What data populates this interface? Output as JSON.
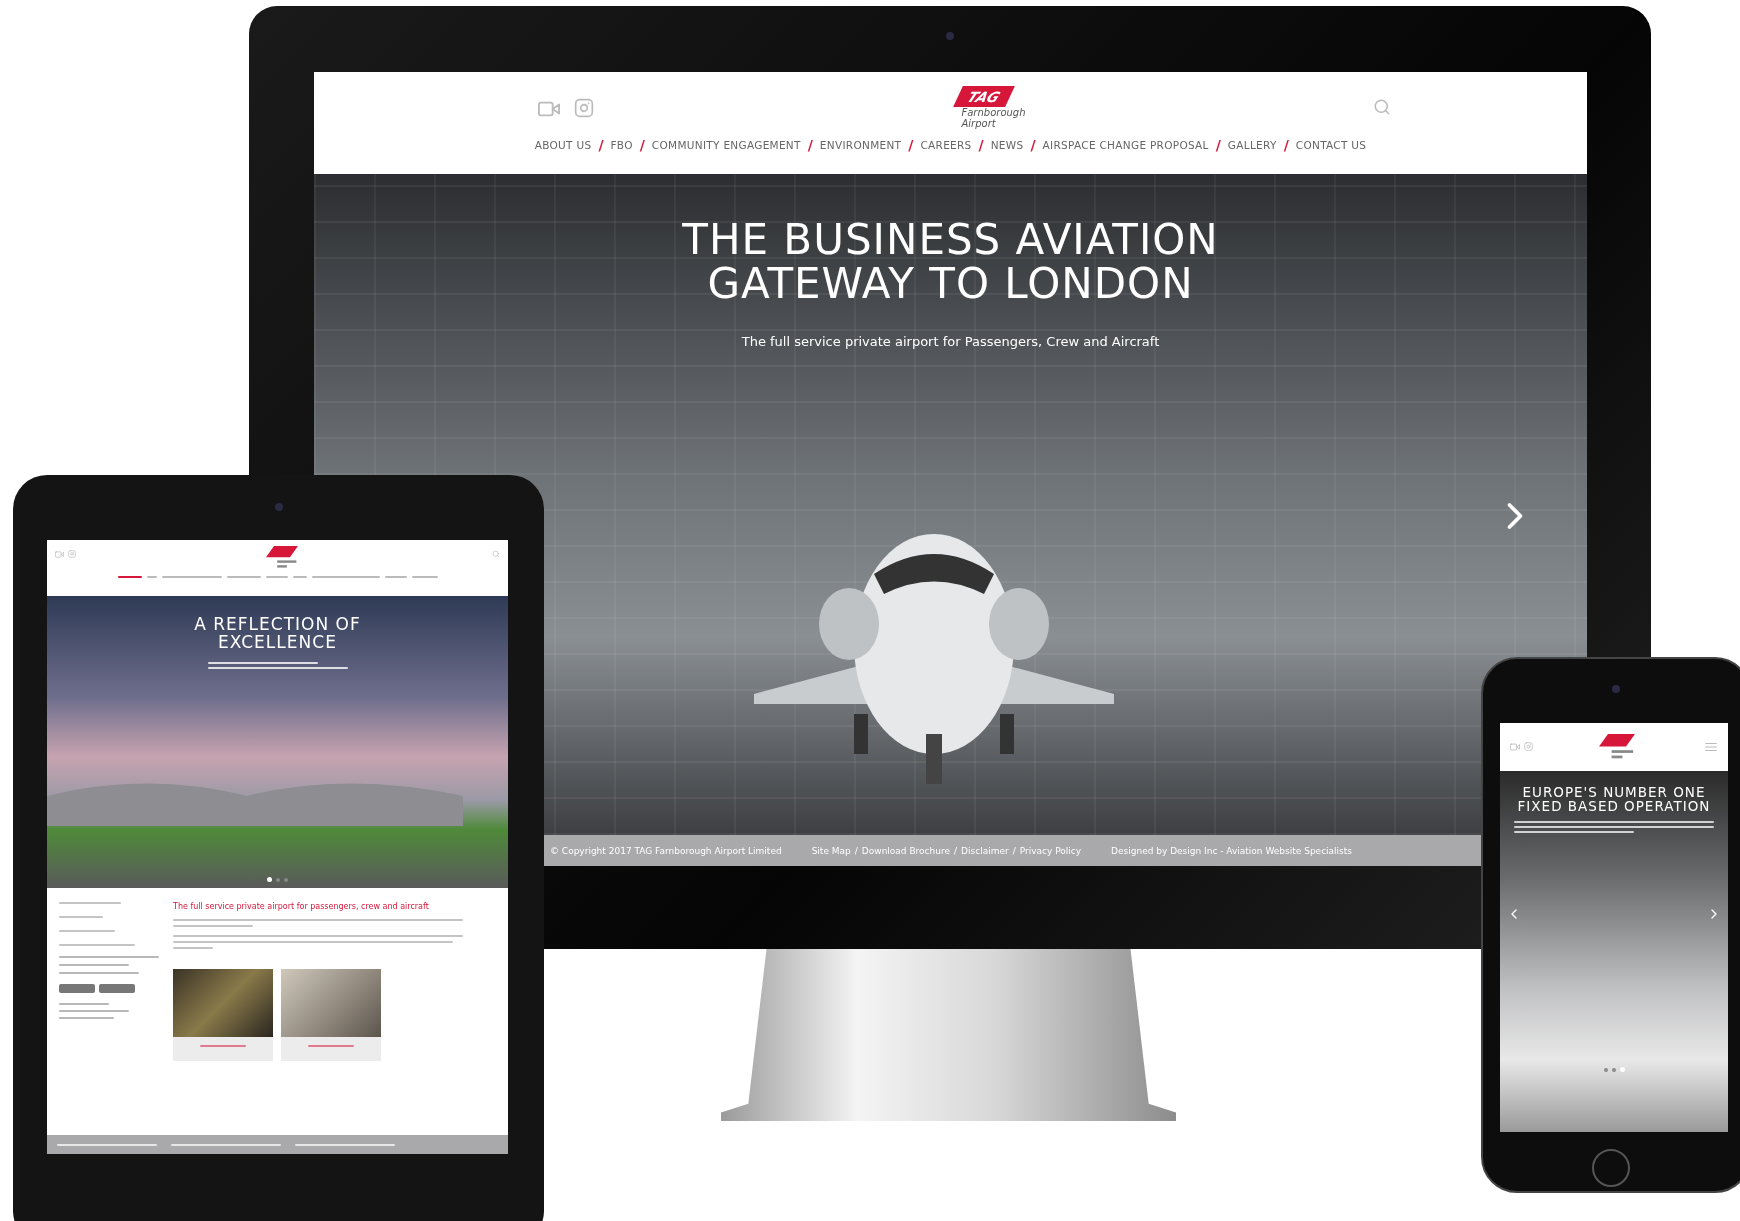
{
  "nav_separator": "/",
  "footer_separator": "/",
  "desktop": {
    "logo": {
      "badge": "TAG",
      "line1": "Farnborough",
      "line2": "Airport"
    },
    "nav": [
      {
        "label": "ABOUT US",
        "selected": false
      },
      {
        "label": "FBO",
        "selected": false
      },
      {
        "label": "COMMUNITY ENGAGEMENT",
        "selected": false
      },
      {
        "label": "ENVIRONMENT",
        "selected": false
      },
      {
        "label": "CAREERS",
        "selected": false
      },
      {
        "label": "NEWS",
        "selected": false
      },
      {
        "label": "AIRSPACE CHANGE PROPOSAL",
        "selected": false
      },
      {
        "label": "GALLERY",
        "selected": false
      },
      {
        "label": "CONTACT US",
        "selected": false
      }
    ],
    "hero": {
      "title_lines": [
        "THE BUSINESS AVIATION",
        "GATEWAY TO LONDON"
      ],
      "subtitle": "The full service private airport for Passengers, Crew and Aircraft"
    },
    "footer": {
      "copyright": "© Copyright 2017 TAG Farnborough Airport Limited",
      "links": [
        "Site Map",
        "Download Brochure",
        "Disclaimer",
        "Privacy Policy"
      ],
      "credit": "Designed by Design Inc - Aviation Website Specialists"
    }
  },
  "tablet": {
    "hero": {
      "title_lines": [
        "A REFLECTION OF",
        "EXCELLENCE"
      ],
      "dots": [
        {
          "selected": true
        },
        {
          "selected": false
        },
        {
          "selected": false
        }
      ]
    },
    "heading": "The full service private airport for passengers, crew and aircraft"
  },
  "phone": {
    "hero": {
      "title_lines": [
        "EUROPE'S NUMBER ONE",
        "FIXED BASED OPERATION"
      ],
      "dots": [
        {
          "selected": false
        },
        {
          "selected": false
        },
        {
          "selected": true
        }
      ]
    }
  }
}
